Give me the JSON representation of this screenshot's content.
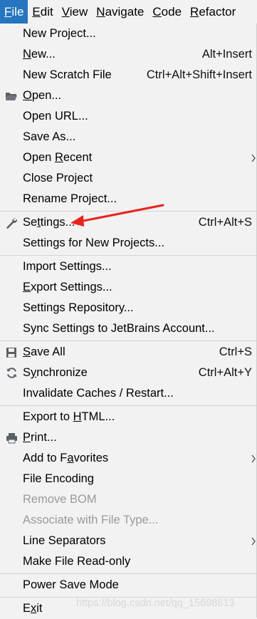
{
  "menubar": {
    "items": [
      {
        "pre": "",
        "u": "F",
        "post": "ile"
      },
      {
        "pre": "",
        "u": "E",
        "post": "dit"
      },
      {
        "pre": "",
        "u": "V",
        "post": "iew"
      },
      {
        "pre": "",
        "u": "N",
        "post": "avigate"
      },
      {
        "pre": "",
        "u": "C",
        "post": "ode"
      },
      {
        "pre": "",
        "u": "R",
        "post": "efactor"
      }
    ]
  },
  "menu": {
    "new_project": {
      "pre": "New Project...",
      "u": "",
      "post": ""
    },
    "new": {
      "pre": "",
      "u": "N",
      "post": "ew...",
      "shortcut": "Alt+Insert"
    },
    "new_scratch": {
      "pre": "New Scratch File",
      "u": "",
      "post": "",
      "shortcut": "Ctrl+Alt+Shift+Insert"
    },
    "open": {
      "pre": "",
      "u": "O",
      "post": "pen..."
    },
    "open_url": {
      "pre": "Open URL...",
      "u": "",
      "post": ""
    },
    "save_as": {
      "pre": "Save As...",
      "u": "",
      "post": ""
    },
    "open_recent": {
      "pre": "Open ",
      "u": "R",
      "post": "ecent"
    },
    "close_project": {
      "pre": "Close Project",
      "u": "",
      "post": ""
    },
    "rename_project": {
      "pre": "Rename Project...",
      "u": "",
      "post": ""
    },
    "settings": {
      "pre": "Se",
      "u": "t",
      "post": "tings...",
      "shortcut": "Ctrl+Alt+S"
    },
    "settings_new": {
      "pre": "Settings for New Projects...",
      "u": "",
      "post": ""
    },
    "import_settings": {
      "pre": "Import Settings...",
      "u": "",
      "post": ""
    },
    "export_settings": {
      "pre": "",
      "u": "E",
      "post": "xport Settings..."
    },
    "settings_repo": {
      "pre": "Settings Repository...",
      "u": "",
      "post": ""
    },
    "sync_settings": {
      "pre": "Sync Settings to JetBrains Account...",
      "u": "",
      "post": ""
    },
    "save_all": {
      "pre": "",
      "u": "S",
      "post": "ave All",
      "shortcut": "Ctrl+S"
    },
    "synchronize": {
      "pre": "S",
      "u": "y",
      "post": "nchronize",
      "shortcut": "Ctrl+Alt+Y"
    },
    "invalidate": {
      "pre": "Invalidate Caches / Restart...",
      "u": "",
      "post": ""
    },
    "export_html": {
      "pre": "Export to ",
      "u": "H",
      "post": "TML..."
    },
    "print": {
      "pre": "",
      "u": "P",
      "post": "rint..."
    },
    "add_favorites": {
      "pre": "Add to F",
      "u": "a",
      "post": "vorites"
    },
    "file_encoding": {
      "pre": "File Encoding",
      "u": "",
      "post": ""
    },
    "remove_bom": {
      "pre": "Remove BOM",
      "u": "",
      "post": ""
    },
    "associate": {
      "pre": "Associate with File Type...",
      "u": "",
      "post": ""
    },
    "line_separators": {
      "pre": "Line Separators",
      "u": "",
      "post": ""
    },
    "make_readonly": {
      "pre": "Make File Read-only",
      "u": "",
      "post": ""
    },
    "power_save": {
      "pre": "Power Save Mode",
      "u": "",
      "post": ""
    },
    "exit": {
      "pre": "E",
      "u": "x",
      "post": "it"
    }
  },
  "icons": {
    "open": "folder-icon",
    "settings": "wrench-icon",
    "save_all": "save-icon",
    "synchronize": "sync-icon",
    "print": "printer-icon"
  },
  "colors": {
    "accent": "#2675bf",
    "annotation_arrow": "#e8231e",
    "menu_bg": "#f2f2f2",
    "disabled_text": "#9a9a9a"
  },
  "watermark": "https://blog.csdn.net/qq_15698613"
}
